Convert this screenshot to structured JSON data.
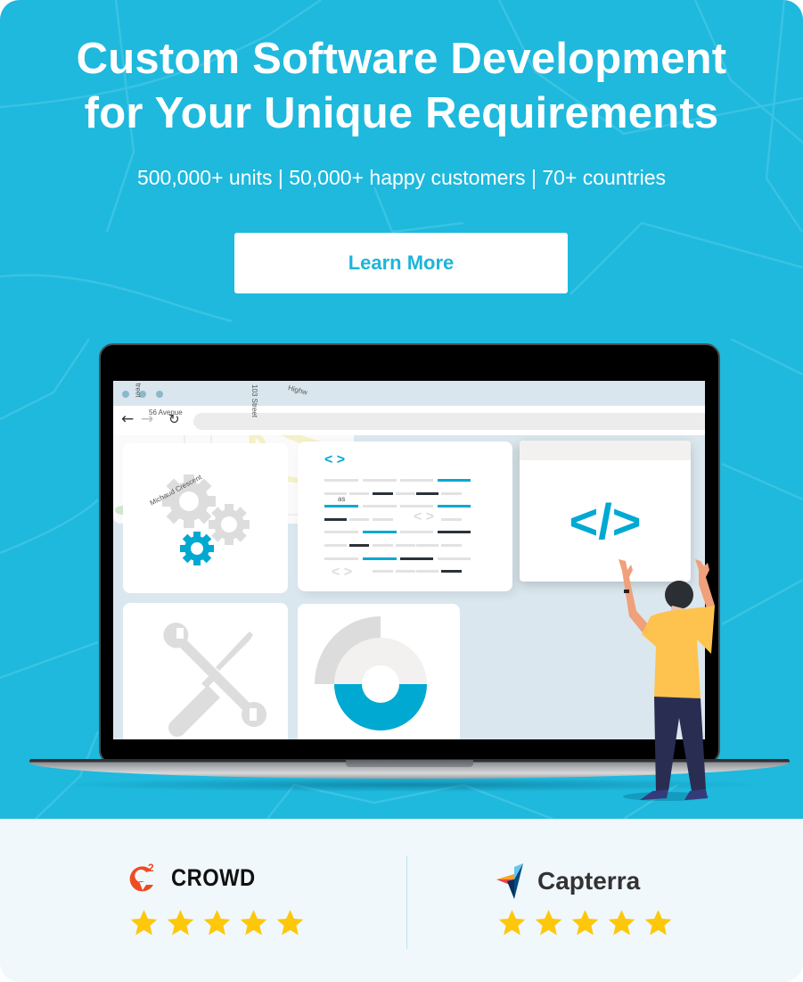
{
  "hero": {
    "headline_line1": "Custom Software Development",
    "headline_line2": "for Your Unique Requirements",
    "stats_line": "500,000+ units | 50,000+ happy customers | 70+ countries",
    "cta_label": "Learn More",
    "colors": {
      "background": "#1eb9dd",
      "cta_text": "#1eb4da",
      "accent": "#00a9d2"
    }
  },
  "illustration": {
    "browser": {
      "back_icon": "←",
      "forward_icon": "→",
      "reload_icon": "↻"
    },
    "code_card": {
      "top_glyph": "< >",
      "bottom_glyph": "< >",
      "mid_glyph": "< >"
    },
    "tag_card": {
      "glyph": "</>"
    },
    "map_labels": [
      "56 Avenue",
      "Michaud Crescent",
      "103 Street",
      "treet",
      "Highw",
      "as"
    ]
  },
  "ratings": {
    "items": [
      {
        "brand": "CROWD",
        "logo": "g2-crowd-logo",
        "stars": 5,
        "max_stars": 5
      },
      {
        "brand": "Capterra",
        "logo": "capterra-logo",
        "stars": 5,
        "max_stars": 5
      }
    ],
    "star_color": "#fdc70c"
  }
}
